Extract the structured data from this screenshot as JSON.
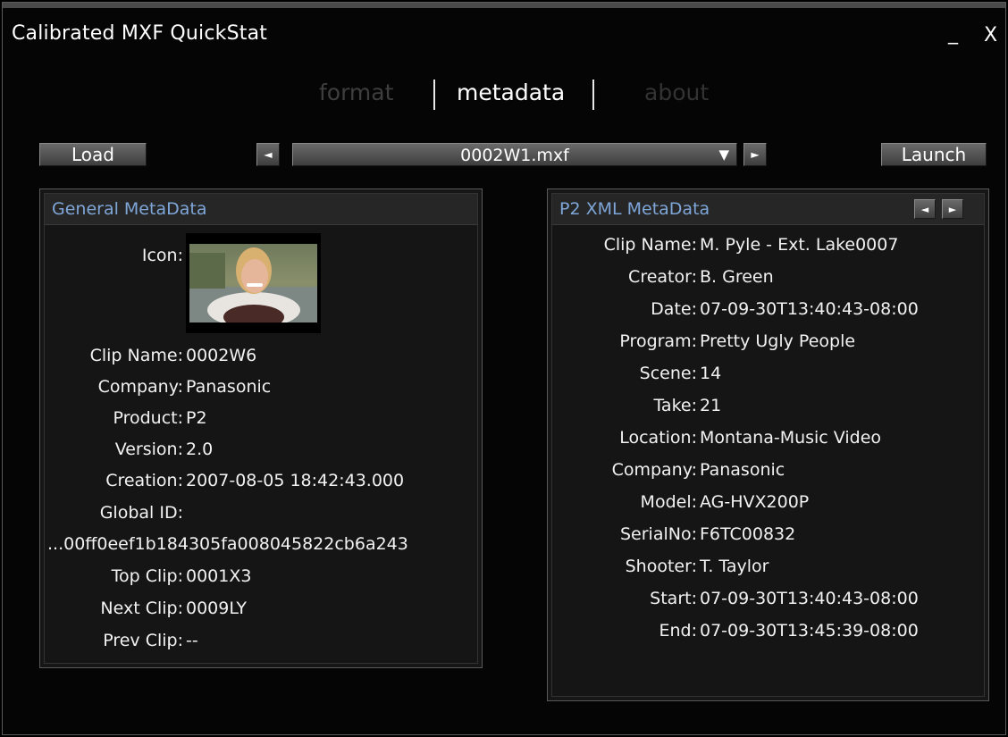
{
  "app": {
    "title": "Calibrated MXF QuickStat",
    "minimize": "_",
    "close": "X"
  },
  "tabs": {
    "format": "format",
    "metadata": "metadata",
    "about": "about"
  },
  "toolbar": {
    "load_label": "Load",
    "launch_label": "Launch",
    "file_name": "0002W1.mxf",
    "prev_icon": "◄",
    "next_icon": "►",
    "dropdown_icon": "▼"
  },
  "general": {
    "title": "General MetaData",
    "icon_label": "Icon:",
    "fields": [
      {
        "label": "Clip Name:",
        "value": "0002W6"
      },
      {
        "label": "Company:",
        "value": "Panasonic"
      },
      {
        "label": "Product:",
        "value": "P2"
      },
      {
        "label": "Version:",
        "value": "2.0"
      },
      {
        "label": "Creation:",
        "value": "2007-08-05 18:42:43.000"
      },
      {
        "label": "Global ID:",
        "value": ""
      }
    ],
    "global_id_value": "...00ff0eef1b184305fa008045822cb6a243",
    "fields2": [
      {
        "label": "Top Clip:",
        "value": "0001X3"
      },
      {
        "label": "Next Clip:",
        "value": "0009LY"
      },
      {
        "label": "Prev Clip:",
        "value": "--"
      }
    ]
  },
  "p2": {
    "title": "P2 XML MetaData",
    "fields": [
      {
        "label": "Clip Name:",
        "value": "M. Pyle - Ext. Lake0007"
      },
      {
        "label": "Creator:",
        "value": "B. Green"
      },
      {
        "label": "Date:",
        "value": "07-09-30T13:40:43-08:00"
      },
      {
        "label": "Program:",
        "value": "Pretty Ugly People"
      },
      {
        "label": "Scene:",
        "value": "14"
      },
      {
        "label": "Take:",
        "value": "21"
      },
      {
        "label": "Location:",
        "value": "Montana-Music Video"
      },
      {
        "label": "Company:",
        "value": "Panasonic"
      },
      {
        "label": "Model:",
        "value": "AG-HVX200P"
      },
      {
        "label": "SerialNo:",
        "value": "F6TC00832"
      },
      {
        "label": "Shooter:",
        "value": "T. Taylor"
      },
      {
        "label": "Start:",
        "value": "07-09-30T13:40:43-08:00"
      },
      {
        "label": "End:",
        "value": "07-09-30T13:45:39-08:00"
      }
    ]
  },
  "colors": {
    "panel_title": "#7ea6d8",
    "background": "#050505"
  }
}
